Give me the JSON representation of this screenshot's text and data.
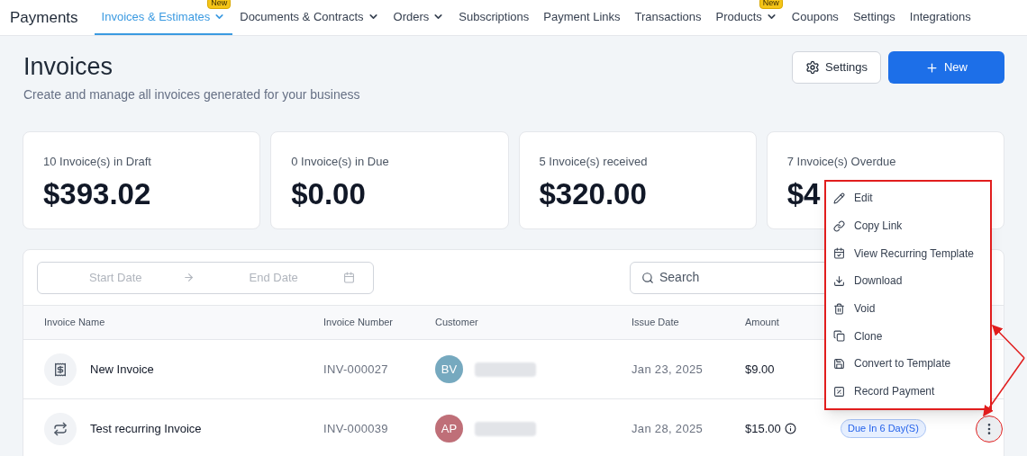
{
  "app_title": "Payments",
  "nav": [
    {
      "label": "Invoices & Estimates",
      "selected": true,
      "dropdown": true,
      "badge": "New"
    },
    {
      "label": "Documents & Contracts",
      "selected": false,
      "dropdown": true
    },
    {
      "label": "Orders",
      "selected": false,
      "dropdown": true
    },
    {
      "label": "Subscriptions",
      "selected": false,
      "dropdown": false
    },
    {
      "label": "Payment Links",
      "selected": false,
      "dropdown": false
    },
    {
      "label": "Transactions",
      "selected": false,
      "dropdown": false
    },
    {
      "label": "Products",
      "selected": false,
      "dropdown": true,
      "badge": "New"
    },
    {
      "label": "Coupons",
      "selected": false,
      "dropdown": false
    },
    {
      "label": "Settings",
      "selected": false,
      "dropdown": false
    },
    {
      "label": "Integrations",
      "selected": false,
      "dropdown": false
    }
  ],
  "page": {
    "title": "Invoices",
    "subtitle": "Create and manage all invoices generated for your business",
    "settings_button": "Settings",
    "new_button": "New"
  },
  "stats": [
    {
      "label": "10 Invoice(s) in Draft",
      "value": "$393.02"
    },
    {
      "label": "0 Invoice(s) in Due",
      "value": "$0.00"
    },
    {
      "label": "5 Invoice(s) received",
      "value": "$320.00"
    },
    {
      "label": "7 Invoice(s) Overdue",
      "value": "$4"
    }
  ],
  "filters": {
    "start_placeholder": "Start Date",
    "end_placeholder": "End Date",
    "search_placeholder": "Search"
  },
  "table": {
    "columns": [
      "Invoice Name",
      "Invoice Number",
      "Customer",
      "Issue Date",
      "Amount"
    ],
    "rows": [
      {
        "kind": "single",
        "name": "New Invoice",
        "number": "INV-000027",
        "initials": "BV",
        "color": "#76a9bf",
        "issue_date": "Jan 23, 2025",
        "amount": "$9.00",
        "info": false
      },
      {
        "kind": "recurring",
        "name": "Test recurring Invoice",
        "number": "INV-000039",
        "initials": "AP",
        "color": "#bf6f78",
        "issue_date": "Jan 28, 2025",
        "amount": "$15.00",
        "info": true,
        "status": "Due In 6 Day(S)",
        "more_button": true
      }
    ]
  },
  "menu": [
    {
      "kind": "edit",
      "label": "Edit"
    },
    {
      "kind": "link",
      "label": "Copy Link"
    },
    {
      "kind": "calendar",
      "label": "View Recurring Template"
    },
    {
      "kind": "download",
      "label": "Download"
    },
    {
      "kind": "trash",
      "label": "Void"
    },
    {
      "kind": "copy",
      "label": "Clone"
    },
    {
      "kind": "save",
      "label": "Convert to Template"
    },
    {
      "kind": "percent",
      "label": "Record Payment"
    }
  ]
}
